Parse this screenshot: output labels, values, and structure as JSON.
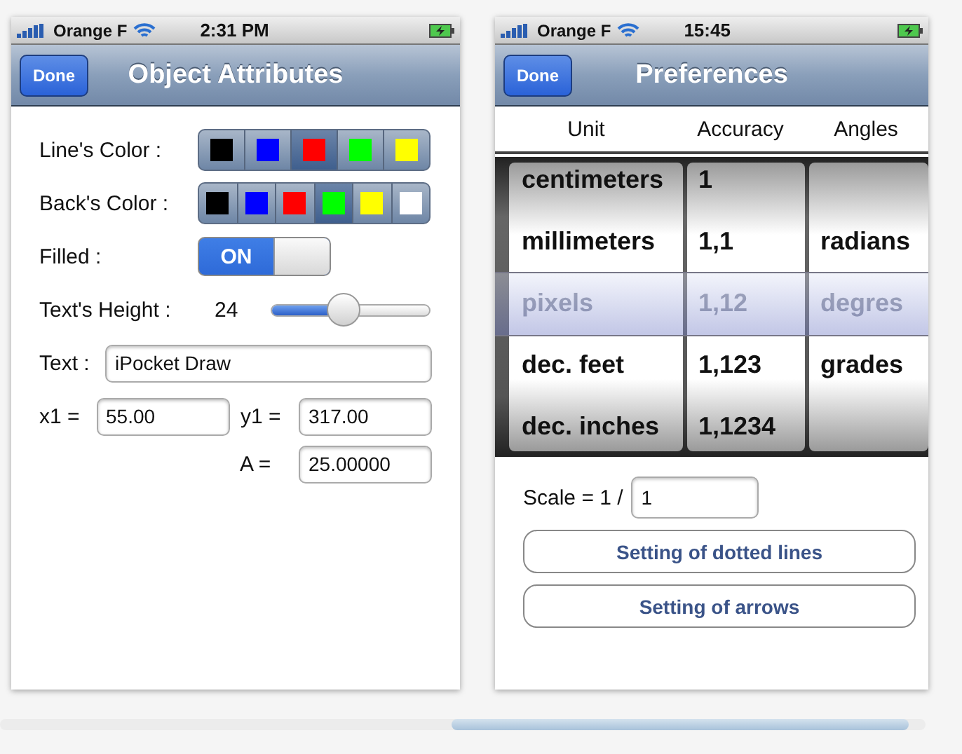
{
  "screens": [
    {
      "status_bar": {
        "carrier": "Orange F",
        "time": "2:31 PM"
      },
      "nav_bar": {
        "button": "Done",
        "title": "Object Attributes"
      },
      "line_color": {
        "label": "Line's Color :",
        "swatches": [
          {
            "color": "#000000",
            "selected": false
          },
          {
            "color": "#0000ff",
            "selected": false
          },
          {
            "color": "#ff0000",
            "selected": true
          },
          {
            "color": "#00ff00",
            "selected": false
          },
          {
            "color": "#ffff00",
            "selected": false
          }
        ]
      },
      "back_color": {
        "label": "Back's Color :",
        "swatches": [
          {
            "color": "#000000",
            "selected": false
          },
          {
            "color": "#0000ff",
            "selected": false
          },
          {
            "color": "#ff0000",
            "selected": false
          },
          {
            "color": "#00ff00",
            "selected": true
          },
          {
            "color": "#ffff00",
            "selected": false
          },
          {
            "color": "#ffffff",
            "selected": false
          }
        ]
      },
      "filled": {
        "label": "Filled :",
        "on": true,
        "on_text": "ON"
      },
      "text_height": {
        "label": "Text's Height :",
        "reading": "24",
        "level": 0.44
      },
      "text": {
        "label": "Text :",
        "value": "iPocket Draw"
      },
      "x1": {
        "label": "x1 =",
        "value": "55.00"
      },
      "y1": {
        "label": "y1 =",
        "value": "317.00"
      },
      "a": {
        "label": "A =",
        "value": "25.00000"
      }
    },
    {
      "status_bar": {
        "carrier": "Orange F",
        "time": "15:45"
      },
      "nav_bar": {
        "button": "Done",
        "title": "Preferences"
      },
      "picker": {
        "headers": [
          "Unit",
          "Accuracy",
          "Angles"
        ],
        "rows": [
          {
            "unit": "centimeters",
            "accuracy": "1",
            "selected": false
          },
          {
            "unit": "millimeters",
            "accuracy": "1,1",
            "angle": "radians",
            "selected": false
          },
          {
            "unit": "pixels",
            "accuracy": "1,12",
            "angle": "degres",
            "selected": true
          },
          {
            "unit": "dec. feet",
            "accuracy": "1,123",
            "angle": "grades",
            "selected": false
          },
          {
            "unit": "dec. inches",
            "accuracy": "1,1234",
            "selected": false
          }
        ]
      },
      "scale": {
        "label": "Scale = 1 /",
        "value": "1"
      },
      "buttons": [
        "Setting of dotted lines",
        "Setting of arrows"
      ]
    }
  ]
}
